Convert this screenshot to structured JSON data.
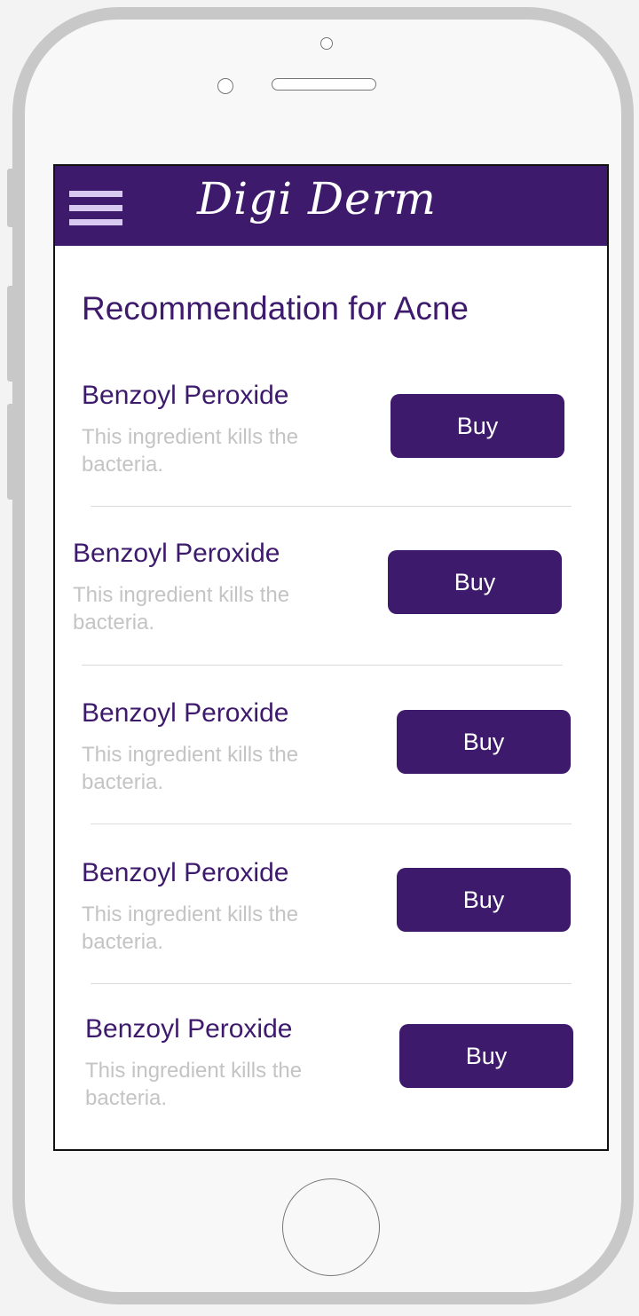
{
  "app": {
    "brand": "Digi Derm"
  },
  "page": {
    "title": "Recommendation for Acne"
  },
  "products": [
    {
      "name": "Benzoyl Peroxide",
      "description": "This ingredient kills the bacteria.",
      "button_label": "Buy"
    },
    {
      "name": "Benzoyl Peroxide",
      "description": "This ingredient kills the bacteria.",
      "button_label": "Buy"
    },
    {
      "name": "Benzoyl Peroxide",
      "description": "This ingredient kills the bacteria.",
      "button_label": "Buy"
    },
    {
      "name": "Benzoyl Peroxide",
      "description": "This ingredient kills the bacteria.",
      "button_label": "Buy"
    },
    {
      "name": "Benzoyl Peroxide",
      "description": "This ingredient kills the bacteria.",
      "button_label": "Buy"
    }
  ],
  "icons": {
    "menu": "hamburger-menu-icon"
  },
  "colors": {
    "brand": "#3e1a6c",
    "description_text": "#c4c4c4",
    "screen_background": "#ffffff"
  }
}
